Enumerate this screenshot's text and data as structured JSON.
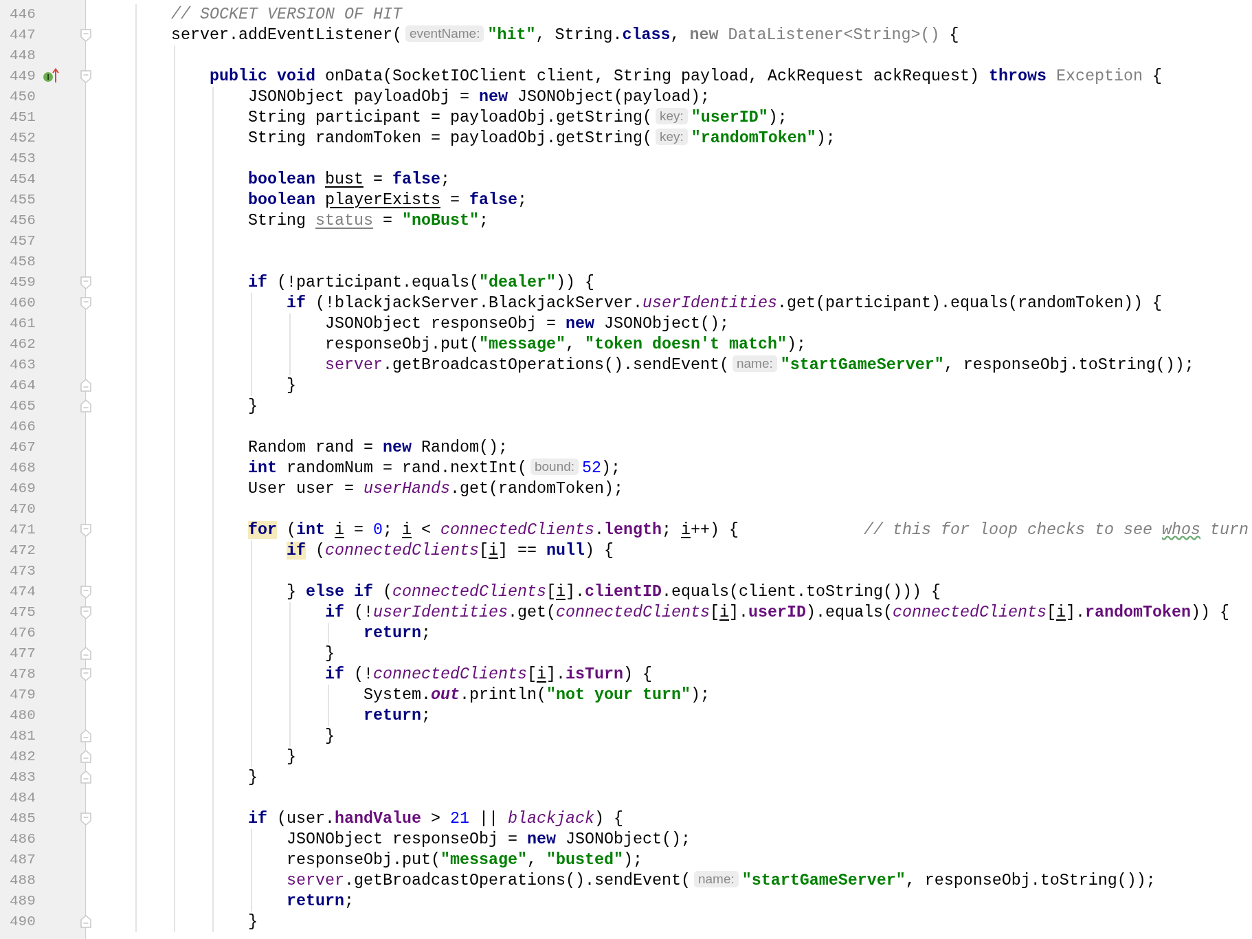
{
  "editor": {
    "lines": [
      {
        "number": "446",
        "block_start": false,
        "block_end": false,
        "tokens": [
          {
            "kind": "comment",
            "text": "    // SOCKET VERSION OF HIT"
          }
        ]
      },
      {
        "number": "447",
        "block_start": true,
        "block_end": false,
        "tokens": [
          {
            "kind": "plain",
            "text": "    server.addEventListener("
          },
          {
            "kind": "hint",
            "text": "eventName:"
          },
          {
            "kind": "string",
            "text": "\"hit\""
          },
          {
            "kind": "plain",
            "text": ", String."
          },
          {
            "kind": "keyword",
            "text": "class"
          },
          {
            "kind": "plain",
            "text": ", "
          },
          {
            "kind": "dimkeyword",
            "text": "new"
          },
          {
            "kind": "dim",
            "text": " DataListener<String>()"
          },
          {
            "kind": "plain",
            "text": " {"
          }
        ]
      },
      {
        "number": "448",
        "block_start": false,
        "block_end": false
      },
      {
        "number": "449",
        "block_start": true,
        "block_end": false,
        "gutter_icon": {
          "kind": "implements",
          "letter": "I"
        },
        "tokens": [
          {
            "kind": "keyword",
            "text": "        public"
          },
          {
            "kind": "keyword",
            "text": " void"
          },
          {
            "kind": "plain",
            "text": " onData(SocketIOClient client, String payload, AckRequest ackRequest) "
          },
          {
            "kind": "keyword",
            "text": "throws"
          },
          {
            "kind": "dim",
            "text": " Exception"
          },
          {
            "kind": "plain",
            "text": " {"
          }
        ]
      },
      {
        "number": "450",
        "block_start": false,
        "block_end": false,
        "tokens": [
          {
            "kind": "plain",
            "text": "            JSONObject payloadObj = "
          },
          {
            "kind": "keyword",
            "text": "new"
          },
          {
            "kind": "plain",
            "text": " JSONObject(payload);"
          }
        ]
      },
      {
        "number": "451",
        "block_start": false,
        "block_end": false,
        "tokens": [
          {
            "kind": "plain",
            "text": "            String participant = payloadObj.getString("
          },
          {
            "kind": "hint",
            "text": "key:"
          },
          {
            "kind": "string",
            "text": "\"userID\""
          },
          {
            "kind": "plain",
            "text": ");"
          }
        ]
      },
      {
        "number": "452",
        "block_start": false,
        "block_end": false,
        "tokens": [
          {
            "kind": "plain",
            "text": "            String randomToken = payloadObj.getString("
          },
          {
            "kind": "hint",
            "text": "key:"
          },
          {
            "kind": "string",
            "text": "\"randomToken\""
          },
          {
            "kind": "plain",
            "text": ");"
          }
        ]
      },
      {
        "number": "453",
        "block_start": false,
        "block_end": false
      },
      {
        "number": "454",
        "block_start": false,
        "block_end": false,
        "tokens": [
          {
            "kind": "keyword",
            "text": "            boolean"
          },
          {
            "kind": "underlined",
            "text": " bust"
          },
          {
            "kind": "plain",
            "text": " = "
          },
          {
            "kind": "keyword",
            "text": "false"
          },
          {
            "kind": "plain",
            "text": ";"
          }
        ]
      },
      {
        "number": "455",
        "block_start": false,
        "block_end": false,
        "tokens": [
          {
            "kind": "keyword",
            "text": "            boolean"
          },
          {
            "kind": "underlined",
            "text": " playerExists"
          },
          {
            "kind": "plain",
            "text": " = "
          },
          {
            "kind": "keyword",
            "text": "false"
          },
          {
            "kind": "plain",
            "text": ";"
          }
        ]
      },
      {
        "number": "456",
        "block_start": false,
        "block_end": false,
        "tokens": [
          {
            "kind": "plain",
            "text": "            String "
          },
          {
            "kind": "underlineddim",
            "text": "status"
          },
          {
            "kind": "plain",
            "text": " = "
          },
          {
            "kind": "string",
            "text": "\"noBust\""
          },
          {
            "kind": "plain",
            "text": ";"
          }
        ]
      },
      {
        "number": "457",
        "block_start": false,
        "block_end": false
      },
      {
        "number": "458",
        "block_start": false,
        "block_end": false
      },
      {
        "number": "459",
        "block_start": true,
        "block_end": false,
        "tokens": [
          {
            "kind": "keyword",
            "text": "            if"
          },
          {
            "kind": "plain",
            "text": " (!participant.equals("
          },
          {
            "kind": "string",
            "text": "\"dealer\""
          },
          {
            "kind": "plain",
            "text": ")) {"
          }
        ]
      },
      {
        "number": "460",
        "block_start": true,
        "block_end": false,
        "tokens": [
          {
            "kind": "keyword",
            "text": "                if"
          },
          {
            "kind": "plain",
            "text": " (!blackjackServer.BlackjackServer."
          },
          {
            "kind": "field",
            "text": "userIdentities"
          },
          {
            "kind": "plain",
            "text": ".get(participant).equals(randomToken)) {"
          }
        ]
      },
      {
        "number": "461",
        "block_start": false,
        "block_end": false,
        "tokens": [
          {
            "kind": "plain",
            "text": "                    JSONObject responseObj = "
          },
          {
            "kind": "keyword",
            "text": "new"
          },
          {
            "kind": "plain",
            "text": " JSONObject();"
          }
        ]
      },
      {
        "number": "462",
        "block_start": false,
        "block_end": false,
        "tokens": [
          {
            "kind": "plain",
            "text": "                    responseObj.put("
          },
          {
            "kind": "string",
            "text": "\"message\""
          },
          {
            "kind": "plain",
            "text": ", "
          },
          {
            "kind": "string",
            "text": "\"token doesn't match\""
          },
          {
            "kind": "plain",
            "text": ");"
          }
        ]
      },
      {
        "number": "463",
        "block_start": false,
        "block_end": false,
        "tokens": [
          {
            "kind": "captured",
            "text": "                    server"
          },
          {
            "kind": "plain",
            "text": ".getBroadcastOperations().sendEvent("
          },
          {
            "kind": "hint",
            "text": "name:"
          },
          {
            "kind": "string",
            "text": "\"startGameServer\""
          },
          {
            "kind": "plain",
            "text": ", responseObj.toString());"
          }
        ]
      },
      {
        "number": "464",
        "block_start": false,
        "block_end": true,
        "tokens": [
          {
            "kind": "plain",
            "text": "                }"
          }
        ]
      },
      {
        "number": "465",
        "block_start": false,
        "block_end": true,
        "tokens": [
          {
            "kind": "plain",
            "text": "            }"
          }
        ]
      },
      {
        "number": "466",
        "block_start": false,
        "block_end": false
      },
      {
        "number": "467",
        "block_start": false,
        "block_end": false,
        "tokens": [
          {
            "kind": "plain",
            "text": "            Random rand = "
          },
          {
            "kind": "keyword",
            "text": "new"
          },
          {
            "kind": "plain",
            "text": " Random();"
          }
        ]
      },
      {
        "number": "468",
        "block_start": false,
        "block_end": false,
        "tokens": [
          {
            "kind": "keyword",
            "text": "            int"
          },
          {
            "kind": "plain",
            "text": " randomNum = rand.nextInt("
          },
          {
            "kind": "hint",
            "text": "bound:"
          },
          {
            "kind": "number",
            "text": "52"
          },
          {
            "kind": "plain",
            "text": ");"
          }
        ]
      },
      {
        "number": "469",
        "block_start": false,
        "block_end": false,
        "tokens": [
          {
            "kind": "plain",
            "text": "            User user = "
          },
          {
            "kind": "field",
            "text": "userHands"
          },
          {
            "kind": "plain",
            "text": ".get(randomToken);"
          }
        ]
      },
      {
        "number": "470",
        "block_start": false,
        "block_end": false
      },
      {
        "number": "471",
        "block_start": true,
        "block_end": false,
        "tokens": [
          {
            "kind": "matchkeyword",
            "text": "            for"
          },
          {
            "kind": "plain",
            "text": " ("
          },
          {
            "kind": "keyword",
            "text": "int"
          },
          {
            "kind": "underlined",
            "text": " i"
          },
          {
            "kind": "plain",
            "text": " = "
          },
          {
            "kind": "number",
            "text": "0"
          },
          {
            "kind": "plain",
            "text": "; "
          },
          {
            "kind": "underlined",
            "text": "i"
          },
          {
            "kind": "plain",
            "text": " < "
          },
          {
            "kind": "field",
            "text": "connectedClients"
          },
          {
            "kind": "plain",
            "text": "."
          },
          {
            "kind": "member",
            "text": "length"
          },
          {
            "kind": "plain",
            "text": "; "
          },
          {
            "kind": "underlined",
            "text": "i"
          },
          {
            "kind": "plain",
            "text": "++) {"
          },
          {
            "kind": "comment",
            "text": "             // this for loop checks to see "
          },
          {
            "kind": "typo",
            "text": "whos"
          },
          {
            "kind": "comment",
            "text": " turn"
          }
        ]
      },
      {
        "number": "472",
        "block_start": false,
        "block_end": false,
        "tokens": [
          {
            "kind": "matchkeyword",
            "text": "                if"
          },
          {
            "kind": "plain",
            "text": " ("
          },
          {
            "kind": "field",
            "text": "connectedClients"
          },
          {
            "kind": "plain",
            "text": "["
          },
          {
            "kind": "underlined",
            "text": "i"
          },
          {
            "kind": "plain",
            "text": "] == "
          },
          {
            "kind": "keyword",
            "text": "null"
          },
          {
            "kind": "plain",
            "text": ") {"
          }
        ]
      },
      {
        "number": "473",
        "block_start": false,
        "block_end": false
      },
      {
        "number": "474",
        "block_start": true,
        "block_end": false,
        "tokens": [
          {
            "kind": "plain",
            "text": "                } "
          },
          {
            "kind": "keyword",
            "text": "else"
          },
          {
            "kind": "keyword",
            "text": " if"
          },
          {
            "kind": "plain",
            "text": " ("
          },
          {
            "kind": "field",
            "text": "connectedClients"
          },
          {
            "kind": "plain",
            "text": "["
          },
          {
            "kind": "underlined",
            "text": "i"
          },
          {
            "kind": "plain",
            "text": "]."
          },
          {
            "kind": "member",
            "text": "clientID"
          },
          {
            "kind": "plain",
            "text": ".equals(client.toString())) {"
          }
        ]
      },
      {
        "number": "475",
        "block_start": true,
        "block_end": false,
        "tokens": [
          {
            "kind": "keyword",
            "text": "                    if"
          },
          {
            "kind": "plain",
            "text": " (!"
          },
          {
            "kind": "field",
            "text": "userIdentities"
          },
          {
            "kind": "plain",
            "text": ".get("
          },
          {
            "kind": "field",
            "text": "connectedClients"
          },
          {
            "kind": "plain",
            "text": "["
          },
          {
            "kind": "underlined",
            "text": "i"
          },
          {
            "kind": "plain",
            "text": "]."
          },
          {
            "kind": "member",
            "text": "userID"
          },
          {
            "kind": "plain",
            "text": ").equals("
          },
          {
            "kind": "field",
            "text": "connectedClients"
          },
          {
            "kind": "plain",
            "text": "["
          },
          {
            "kind": "underlined",
            "text": "i"
          },
          {
            "kind": "plain",
            "text": "]."
          },
          {
            "kind": "member",
            "text": "randomToken"
          },
          {
            "kind": "plain",
            "text": ")) {"
          }
        ]
      },
      {
        "number": "476",
        "block_start": false,
        "block_end": false,
        "tokens": [
          {
            "kind": "keyword",
            "text": "                        return"
          },
          {
            "kind": "plain",
            "text": ";"
          }
        ]
      },
      {
        "number": "477",
        "block_start": false,
        "block_end": true,
        "tokens": [
          {
            "kind": "plain",
            "text": "                    }"
          }
        ]
      },
      {
        "number": "478",
        "block_start": true,
        "block_end": false,
        "tokens": [
          {
            "kind": "keyword",
            "text": "                    if"
          },
          {
            "kind": "plain",
            "text": " (!"
          },
          {
            "kind": "field",
            "text": "connectedClients"
          },
          {
            "kind": "plain",
            "text": "["
          },
          {
            "kind": "underlined",
            "text": "i"
          },
          {
            "kind": "plain",
            "text": "]."
          },
          {
            "kind": "member",
            "text": "isTurn"
          },
          {
            "kind": "plain",
            "text": ") {"
          }
        ]
      },
      {
        "number": "479",
        "block_start": false,
        "block_end": false,
        "tokens": [
          {
            "kind": "plain",
            "text": "                        System."
          },
          {
            "kind": "staticfield",
            "text": "out"
          },
          {
            "kind": "plain",
            "text": ".println("
          },
          {
            "kind": "string",
            "text": "\"not your turn\""
          },
          {
            "kind": "plain",
            "text": ");"
          }
        ]
      },
      {
        "number": "480",
        "block_start": false,
        "block_end": false,
        "tokens": [
          {
            "kind": "keyword",
            "text": "                        return"
          },
          {
            "kind": "plain",
            "text": ";"
          }
        ]
      },
      {
        "number": "481",
        "block_start": false,
        "block_end": true,
        "tokens": [
          {
            "kind": "plain",
            "text": "                    }"
          }
        ]
      },
      {
        "number": "482",
        "block_start": false,
        "block_end": true,
        "tokens": [
          {
            "kind": "plain",
            "text": "                }"
          }
        ]
      },
      {
        "number": "483",
        "block_start": false,
        "block_end": true,
        "tokens": [
          {
            "kind": "plain",
            "text": "            }"
          }
        ]
      },
      {
        "number": "484",
        "block_start": false,
        "block_end": false
      },
      {
        "number": "485",
        "block_start": true,
        "block_end": false,
        "tokens": [
          {
            "kind": "keyword",
            "text": "            if"
          },
          {
            "kind": "plain",
            "text": " (user."
          },
          {
            "kind": "member",
            "text": "handValue"
          },
          {
            "kind": "plain",
            "text": " > "
          },
          {
            "kind": "number",
            "text": "21"
          },
          {
            "kind": "plain",
            "text": " || "
          },
          {
            "kind": "field",
            "text": "blackjack"
          },
          {
            "kind": "plain",
            "text": ") {"
          }
        ]
      },
      {
        "number": "486",
        "block_start": false,
        "block_end": false,
        "tokens": [
          {
            "kind": "plain",
            "text": "                JSONObject responseObj = "
          },
          {
            "kind": "keyword",
            "text": "new"
          },
          {
            "kind": "plain",
            "text": " JSONObject();"
          }
        ]
      },
      {
        "number": "487",
        "block_start": false,
        "block_end": false,
        "tokens": [
          {
            "kind": "plain",
            "text": "                responseObj.put("
          },
          {
            "kind": "string",
            "text": "\"message\""
          },
          {
            "kind": "plain",
            "text": ", "
          },
          {
            "kind": "string",
            "text": "\"busted\""
          },
          {
            "kind": "plain",
            "text": ");"
          }
        ]
      },
      {
        "number": "488",
        "block_start": false,
        "block_end": false,
        "tokens": [
          {
            "kind": "captured",
            "text": "                server"
          },
          {
            "kind": "plain",
            "text": ".getBroadcastOperations().sendEvent("
          },
          {
            "kind": "hint",
            "text": "name:"
          },
          {
            "kind": "string",
            "text": "\"startGameServer\""
          },
          {
            "kind": "plain",
            "text": ", responseObj.toString());"
          }
        ]
      },
      {
        "number": "489",
        "block_start": false,
        "block_end": false,
        "tokens": [
          {
            "kind": "keyword",
            "text": "                return"
          },
          {
            "kind": "plain",
            "text": ";"
          }
        ]
      },
      {
        "number": "490",
        "block_start": false,
        "block_end": true,
        "tokens": [
          {
            "kind": "plain",
            "text": "            }"
          }
        ]
      }
    ]
  }
}
